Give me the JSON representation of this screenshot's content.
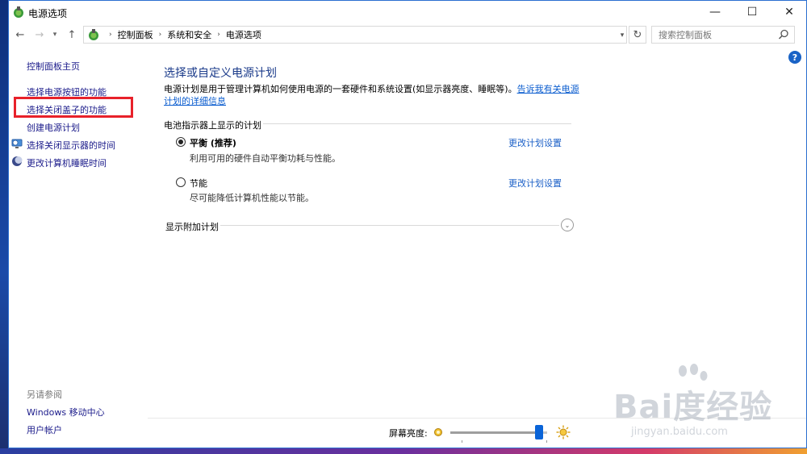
{
  "window": {
    "title": "电源选项",
    "minimize": "—",
    "maximize": "☐",
    "close": "✕"
  },
  "nav": {
    "back": "←",
    "forward": "→",
    "dropdown": "▾",
    "up": "↑",
    "breadcrumbs": [
      "控制面板",
      "系统和安全",
      "电源选项"
    ],
    "crumb_separator": "›",
    "refresh": "↻"
  },
  "search": {
    "placeholder": "搜索控制面板"
  },
  "sidebar": {
    "home": "控制面板主页",
    "items": [
      "选择电源按钮的功能",
      "选择关闭盖子的功能",
      "创建电源计划",
      "选择关闭显示器的时间",
      "更改计算机睡眠时间"
    ],
    "see_also_heading": "另请参阅",
    "see_also": [
      "Windows 移动中心",
      "用户帐户"
    ]
  },
  "main": {
    "title": "选择或自定义电源计划",
    "description": "电源计划是用于管理计算机如何使用电源的一套硬件和系统设置(如显示器亮度、睡眠等)。",
    "description_link": "告诉我有关电源计划的详细信息",
    "section_heading": "电池指示器上显示的计划",
    "plans": [
      {
        "name": "平衡 (推荐)",
        "description": "利用可用的硬件自动平衡功耗与性能。",
        "link": "更改计划设置",
        "selected": true
      },
      {
        "name": "节能",
        "description": "尽可能降低计算机性能以节能。",
        "link": "更改计划设置",
        "selected": false
      }
    ],
    "extra_heading": "显示附加计划",
    "expand": "⌄"
  },
  "bottom": {
    "brightness_label": "屏幕亮度:",
    "brightness_value": 0.92
  },
  "watermark": {
    "text": "Bai度经验",
    "sub": "jingyan.baidu.com"
  },
  "colors": {
    "link": "#1a5fc7",
    "highlight": "#e8212a",
    "slider": "#0a64d8"
  }
}
